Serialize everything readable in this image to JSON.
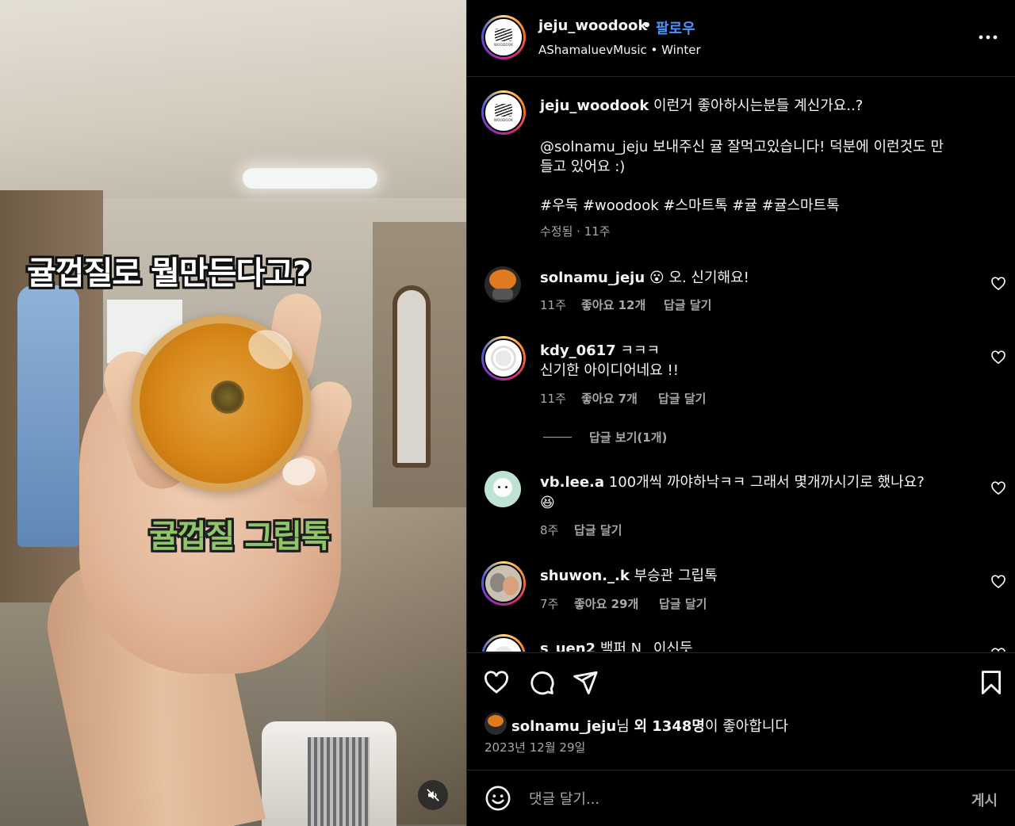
{
  "media": {
    "caption_top": "귤껍질로 뭘만든다고?",
    "caption_bottom": "귤껍질 그립톡",
    "mute_icon": "speaker-muted-icon"
  },
  "header": {
    "username": "jeju_woodook",
    "separator": "•",
    "follow_label": "팔로우",
    "audio_artist": "AShamaluevMusic",
    "audio_separator": "•",
    "audio_track": "Winter",
    "avatar_text": "WOODOOK"
  },
  "caption": {
    "username": "jeju_woodook",
    "line1": "이런거 좋아하시는분들 계신가요..?",
    "line2": "@solnamu_jeju 보내주신 귤 잘먹고있습니다! 덕분에 이런것도 만",
    "line3": "들고 있어요 :)",
    "hashtags": "#우둑 #woodook #스마트톡 #귤 #귤스마트톡",
    "meta": "수정됨 · 11주"
  },
  "comments": [
    {
      "username": "solnamu_jeju",
      "emoji": "😮",
      "text": "오. 신기해요!",
      "time": "11주",
      "likes": "좋아요 12개",
      "reply": "답글 달기"
    },
    {
      "username": "kdy_0617",
      "text": "ㅋㅋㅋ",
      "text2": "신기한 아이디어네요 !!",
      "time": "11주",
      "likes": "좋아요 7개",
      "reply": "답글 달기",
      "view_replies": "답글 보기(1개)"
    },
    {
      "username": "vb.lee.a",
      "text": "100개씩 까야하낙ㅋㅋ 그래서 몇개까시기로 했나요?",
      "emoji2": "😆",
      "time": "8주",
      "reply": "답글 달기"
    },
    {
      "username": "shuwon._.k",
      "text": "부승관 그립톡",
      "time": "7주",
      "likes": "좋아요 29개",
      "reply": "답글 달기"
    },
    {
      "username": "s_uen2",
      "text": "백퍼 N_ 이신듯"
    }
  ],
  "actions": {
    "like_icon": "heart-icon",
    "comment_icon": "comment-icon",
    "share_icon": "share-icon",
    "save_icon": "bookmark-icon",
    "liked_by_user": "solnamu_jeju",
    "liked_by_suffix1": "님 ",
    "liked_by_count": "외 1348명",
    "liked_by_suffix2": "이 좋아합니다",
    "date": "2023년 12월 29일"
  },
  "add_comment": {
    "placeholder": "댓글 달기...",
    "post_label": "게시",
    "emoji_icon": "smiley-icon"
  },
  "colors": {
    "follow_blue": "#4a95f7",
    "secondary_text": "#a8a8a8",
    "background": "#000000"
  }
}
